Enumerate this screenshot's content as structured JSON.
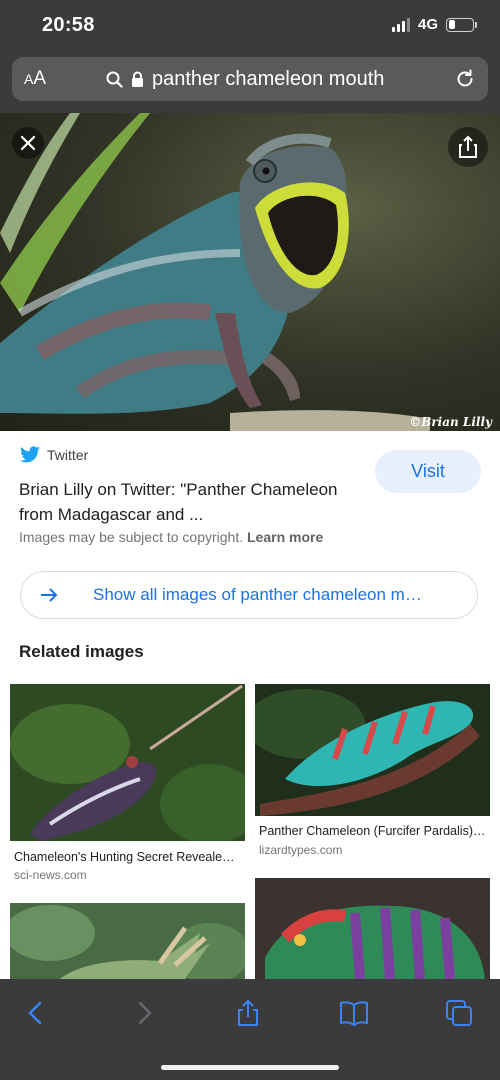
{
  "status": {
    "time": "20:58",
    "network": "4G",
    "signal_level": 0.75,
    "battery_level": 0.25
  },
  "browser": {
    "text_size_label": "AA",
    "url": "panther chameleon mouth",
    "icons": [
      "search-icon",
      "lock-icon",
      "reload-icon"
    ]
  },
  "hero": {
    "watermark": "©Brian Lilly",
    "icons": [
      "close-icon",
      "share-icon"
    ]
  },
  "result": {
    "source": "Twitter",
    "title": "Brian Lilly on Twitter: \"Panther Chameleon from Madagascar and ...",
    "copyright_text": "Images may be subject to copyright.",
    "learn_more": "Learn more",
    "visit_label": "Visit",
    "show_all": "Show all images of panther chameleon m…"
  },
  "related": {
    "heading": "Related images",
    "items": [
      {
        "caption": "Chameleon's Hunting Secret Reveale…",
        "source": "sci-news.com"
      },
      {
        "caption": "Panther Chameleon (Furcifer Pardalis)…",
        "source": "lizardtypes.com"
      },
      {
        "caption": "",
        "source": ""
      },
      {
        "caption": "",
        "source": ""
      }
    ]
  },
  "toolbar": {
    "icons": [
      "back-icon",
      "forward-icon",
      "share-icon",
      "bookmarks-icon",
      "tabs-icon"
    ]
  },
  "colors": {
    "accent": "#1a73e8",
    "chrome": "#3b3b3d",
    "twitter": "#1da1f2",
    "visit_bg": "#e8f0fe"
  }
}
